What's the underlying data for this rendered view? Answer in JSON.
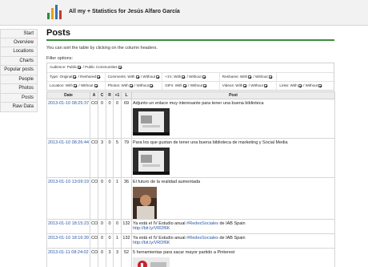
{
  "app": {
    "title": "All my + Statistics for Jesús Alfaro García",
    "colors": {
      "accent": "#3a8f3a",
      "link": "#2b57a6",
      "logo": [
        "#2c8b3a",
        "#e3a11a",
        "#3a6fb5",
        "#c23a2a"
      ]
    }
  },
  "sidebar": {
    "items": [
      {
        "label": "Start"
      },
      {
        "label": "Overview"
      },
      {
        "label": "Locations"
      },
      {
        "label": "Charts"
      },
      {
        "label": "Popular posts"
      },
      {
        "label": "People"
      },
      {
        "label": "Photos"
      },
      {
        "label": "Posts"
      },
      {
        "label": "Raw Data"
      }
    ]
  },
  "page": {
    "title": "Posts",
    "note": "You can sort the table by clicking on the column headers.",
    "filter_label": "Filter options:"
  },
  "filters": {
    "audience": {
      "label": "Audience:",
      "public": "Public",
      "communities": "/ Public Communities"
    },
    "type": {
      "label": "Type: Original",
      "reshared": "/ Reshared"
    },
    "comments": {
      "label": "Comments: With",
      "without": "/ Without"
    },
    "plusones": {
      "label": "+1's: With",
      "without": "/ Without"
    },
    "reshares": {
      "label": "Reshares: With",
      "without": "/ Without"
    },
    "location": {
      "label": "Location: With",
      "without": "/ Without"
    },
    "photos": {
      "label": "Photos: With",
      "without": "/ Without"
    },
    "gifs": {
      "label": "GIFs: With",
      "without": "/ Without"
    },
    "videos": {
      "label": "Videos: With",
      "without": "/ Without"
    },
    "links": {
      "label": "Links: With",
      "without": "/ Without"
    }
  },
  "table": {
    "headers": {
      "date": "Date",
      "a": "A",
      "c": "C",
      "r": "R",
      "plus1": "+1",
      "l": "L",
      "post": "Post"
    },
    "rows": [
      {
        "date": "2013-01-10 08:25:37",
        "a": "CO",
        "c": "0",
        "r": "0",
        "plus1": "0",
        "l": "69",
        "text": "Adjunto un enlace muy interesante para tener una buena biblioteca"
      },
      {
        "date": "2013-01-10 08:26:44",
        "a": "CO",
        "c": "3",
        "r": "0",
        "plus1": "5",
        "l": "79",
        "text": "Para los que gustan de tener una buena biblioteca de marketing y Social Media"
      },
      {
        "date": "2013-01-10 13:09:19",
        "a": "CO",
        "c": "0",
        "r": "0",
        "plus1": "1",
        "l": "36",
        "text": "El futuro de la realidad aumentada"
      },
      {
        "date": "2013-01-10 18:15:23",
        "a": "CO",
        "c": "0",
        "r": "0",
        "plus1": "0",
        "l": "132",
        "text_prefix": "Ya está el IV Estudio anual ",
        "hashtag": "#RedesSociales",
        "text_suffix": " de IAB Spain",
        "link": "http://bit.ly/VRDf6K"
      },
      {
        "date": "2013-01-10 18:16:39",
        "a": "CO",
        "c": "0",
        "r": "0",
        "plus1": "1",
        "l": "132",
        "text_prefix": "Ya está el IV Estudio anual ",
        "hashtag": "#RedesSociales",
        "text_suffix": " de IAB Spain",
        "link": "http://bit.ly/VRDf6K"
      },
      {
        "date": "2013-01-11 08:24:02",
        "a": "CO",
        "c": "0",
        "r": "3",
        "plus1": "3",
        "l": "52",
        "text": "5 herramientas para sacar mayor partido a Pinterest"
      }
    ]
  }
}
